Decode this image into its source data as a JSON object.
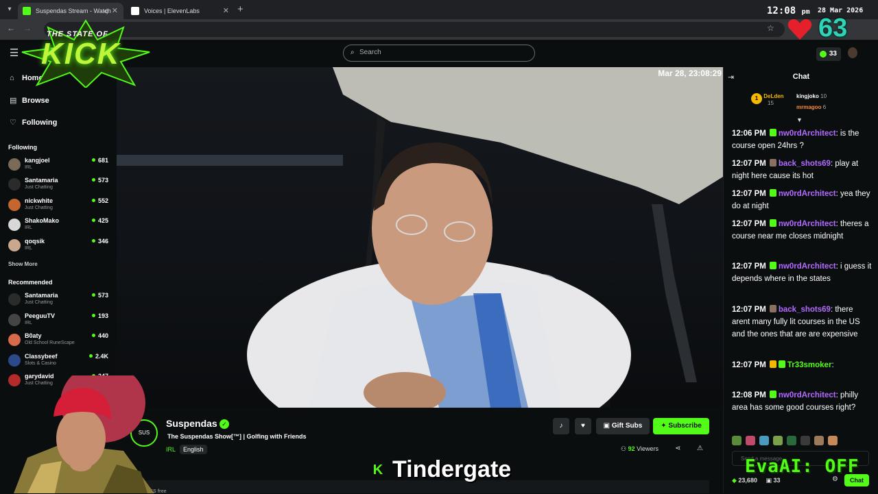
{
  "browser": {
    "tabs": [
      {
        "title": "Suspendas Stream - Watch"
      },
      {
        "title": "Voices | ElevenLabs"
      }
    ],
    "newtab_symbol": "+"
  },
  "overlay": {
    "clock_time": "12:08",
    "clock_ampm": "pm",
    "clock_date": "28 Mar 2026",
    "logo_line1": "THE STATE OF",
    "logo_line2": "KICK",
    "big_number": "63",
    "subtitle_text": "Tindergate",
    "subtitle_mark": "K",
    "eva_status": "EvaAI: OFF"
  },
  "header": {
    "search_placeholder": "Search",
    "points": "33"
  },
  "sidebar": {
    "nav": [
      {
        "label": "Home",
        "icon": "home-icon"
      },
      {
        "label": "Browse",
        "icon": "browse-icon"
      },
      {
        "label": "Following",
        "icon": "heart-icon"
      }
    ],
    "following_title": "Following",
    "following": [
      {
        "name": "kangjoel",
        "category": "IRL",
        "viewers": "681"
      },
      {
        "name": "Santamaria",
        "category": "Just Chatting",
        "viewers": "573"
      },
      {
        "name": "nickwhite",
        "category": "Just Chatting",
        "viewers": "552"
      },
      {
        "name": "ShakoMako",
        "category": "IRL",
        "viewers": "425"
      },
      {
        "name": "qoqsik",
        "category": "IRL",
        "viewers": "346"
      }
    ],
    "show_more": "Show More",
    "recommended_title": "Recommended",
    "recommended": [
      {
        "name": "Santamaria",
        "category": "Just Chatting",
        "viewers": "573"
      },
      {
        "name": "PeeguuTV",
        "category": "IRL",
        "viewers": "193"
      },
      {
        "name": "B0aty",
        "category": "Old School RuneScape",
        "viewers": "440"
      },
      {
        "name": "Classybeef",
        "category": "Slots & Casino",
        "viewers": "2.4K"
      },
      {
        "name": "garydavid",
        "category": "Just Chatting",
        "viewers": "347"
      }
    ]
  },
  "video": {
    "timestamp": "Mar 28, 23:08:29"
  },
  "stream": {
    "channel_name": "Suspendas",
    "avatar_text": "SUS",
    "title": "The Suspendas Show[™] | Golfing with Friends",
    "category": "IRL",
    "language": "English",
    "gift_label": "Gift Subs",
    "subscribe_label": "Subscribe",
    "viewers_count": "92",
    "viewers_label": "Viewers",
    "bottom_label": "KICKS free"
  },
  "chat": {
    "title": "Chat",
    "leaderboard": [
      {
        "rank": "1",
        "name": "DeLden",
        "count": "15"
      },
      {
        "name": "kingjoko",
        "count": "10"
      },
      {
        "name": "mrmagoo",
        "count": "6"
      }
    ],
    "messages": [
      {
        "time": "12:06 PM",
        "user": "nw0rdArchitect",
        "text": ": is the course open 24hrs ?"
      },
      {
        "time": "12:07 PM",
        "user": "back_shots69",
        "text": ": play at night here cause its hot"
      },
      {
        "time": "12:07 PM",
        "user": "nw0rdArchitect",
        "text": ": yea they do at night"
      },
      {
        "time": "12:07 PM",
        "user": "nw0rdArchitect",
        "text": ": theres a course near me closes midnight"
      },
      {
        "time": "12:07 PM",
        "user": "nw0rdArchitect",
        "text": ": i guess it depends where in the states"
      },
      {
        "time": "12:07 PM",
        "user": "back_shots69",
        "text": ": there arent many fully lit courses in the US and the ones that are are expensive"
      },
      {
        "time": "12:07 PM",
        "user": "Tr33smoker",
        "text": ":"
      },
      {
        "time": "12:08 PM",
        "user": "nw0rdArchitect",
        "text": ": philly area has some good courses right?"
      }
    ],
    "input_placeholder": "Send a message",
    "footer_points": "23,680",
    "footer_gifts": "33",
    "chat_button": "Chat"
  },
  "colors": {
    "kick_green": "#53fc18",
    "username_purple": "#b36bff",
    "username_green": "#53fc18",
    "leader_gold": "#f5b800"
  }
}
